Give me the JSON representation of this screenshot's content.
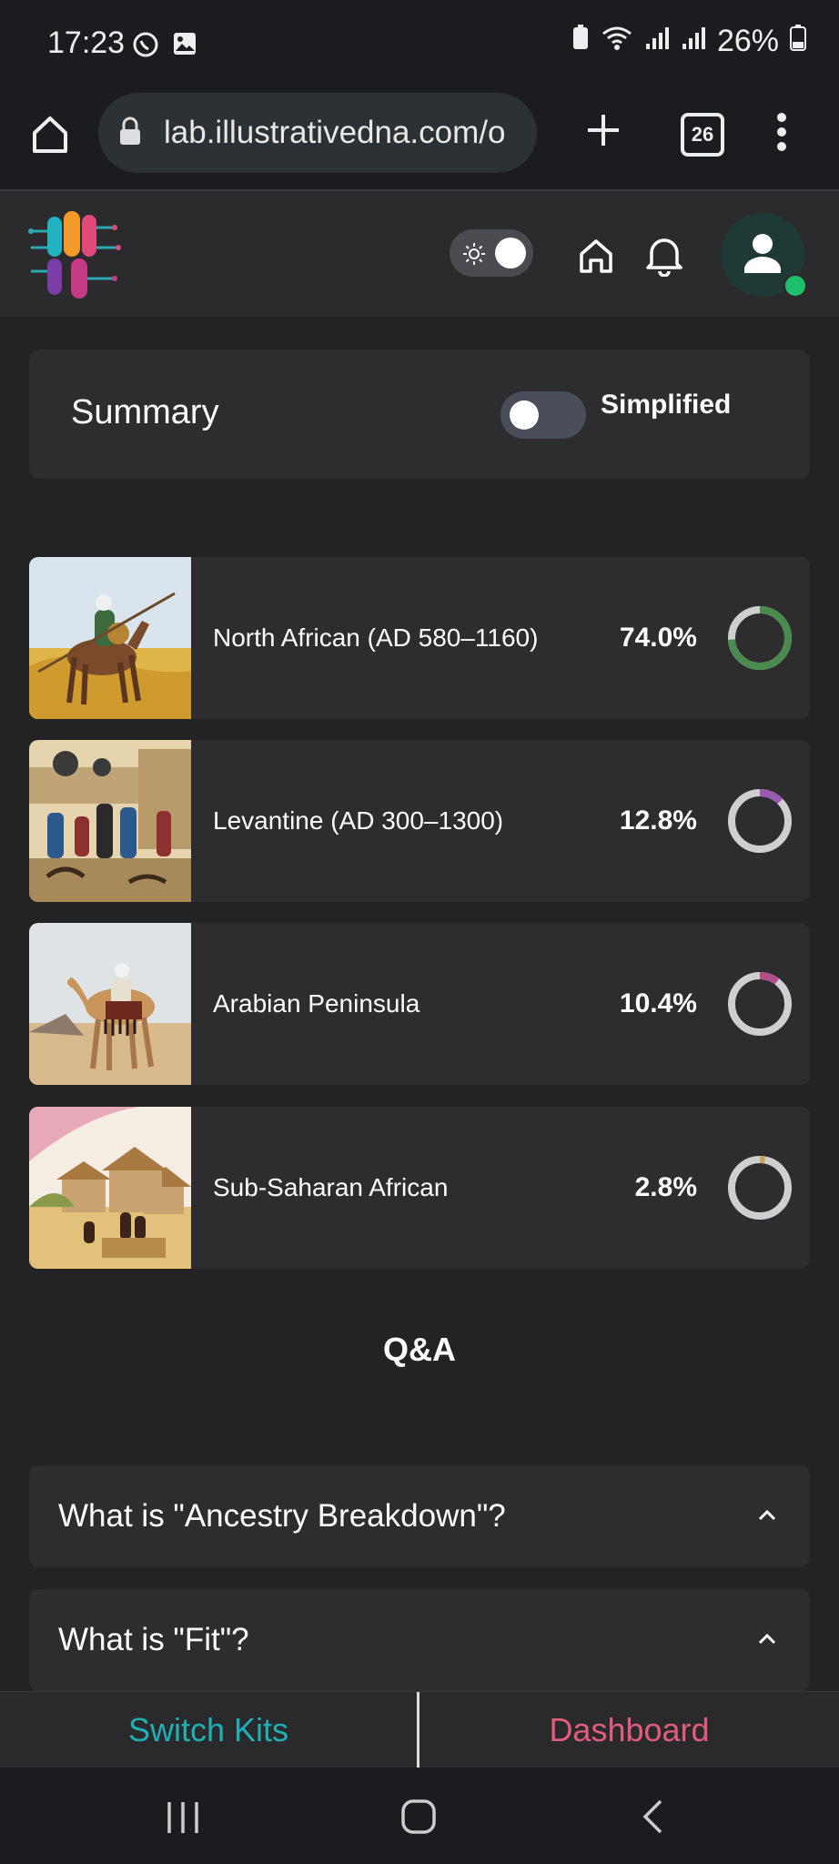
{
  "status_bar": {
    "time": "17:23",
    "battery": "26%",
    "icons": [
      "whatsapp-icon",
      "gallery-icon",
      "battery-saver-icon",
      "wifi-icon",
      "signal-icon",
      "signal-roaming-icon",
      "battery-icon"
    ]
  },
  "browser": {
    "url": "lab.illustrativedna.com/o",
    "tab_count": "26"
  },
  "header": {
    "icons": [
      "logo",
      "sun-icon",
      "home-icon",
      "bell-icon",
      "user-icon"
    ]
  },
  "summary": {
    "title": "Summary",
    "toggle_label": "Simplified",
    "toggle_on": false
  },
  "ancestry": [
    {
      "label": "North African (AD 580–1160)",
      "percent": "74.0%",
      "value": 74.0,
      "color": "#4a8a4e"
    },
    {
      "label": "Levantine (AD 300–1300)",
      "percent": "12.8%",
      "value": 12.8,
      "color": "#9a5bb0"
    },
    {
      "label": "Arabian Peninsula",
      "percent": "10.4%",
      "value": 10.4,
      "color": "#b0508a"
    },
    {
      "label": "Sub-Saharan African",
      "percent": "2.8%",
      "value": 2.8,
      "color": "#c9a45a"
    }
  ],
  "qa": {
    "title": "Q&A",
    "items": [
      {
        "question": "What is \"Ancestry Breakdown\"?"
      },
      {
        "question": "What is \"Fit\"?"
      }
    ]
  },
  "bottom_bar": {
    "left": "Switch Kits",
    "right": "Dashboard"
  },
  "colors": {
    "ring_track": "#cfcfcf",
    "switch_kits": "#1fb0b5",
    "dashboard": "#e25d7d"
  }
}
